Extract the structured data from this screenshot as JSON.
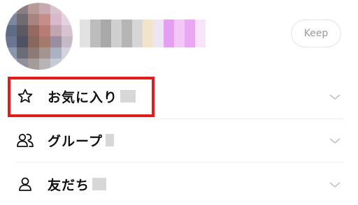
{
  "profile": {
    "keep_label": "Keep"
  },
  "list": {
    "items": [
      {
        "id": "favorites",
        "label": "お気に入り",
        "icon": "star-icon"
      },
      {
        "id": "groups",
        "label": "グループ",
        "icon": "group-icon"
      },
      {
        "id": "friends",
        "label": "友だち",
        "icon": "person-icon"
      }
    ]
  },
  "colors": {
    "highlight": "#e21b1b",
    "divider": "#ececec",
    "keep_text": "#9a9a9a"
  }
}
